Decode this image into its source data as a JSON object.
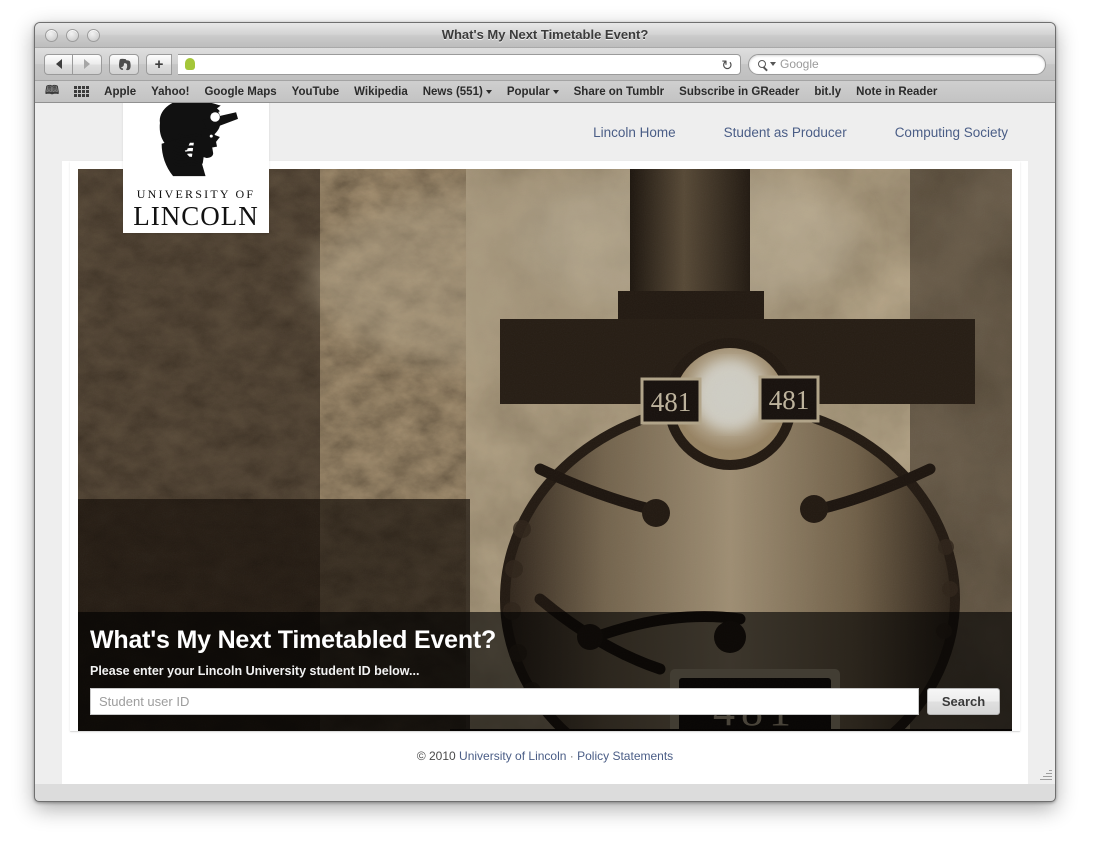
{
  "window": {
    "title": "What's My Next Timetable Event?",
    "traffic_lights": [
      "close-button",
      "minimize-button",
      "zoom-button"
    ]
  },
  "toolbar": {
    "back_icon": "back-arrow-icon",
    "forward_icon": "forward-arrow-icon",
    "evernote_icon": "evernote-elephant-icon",
    "new_tab_label": "+",
    "url_value": "",
    "url_favicon": "android-favicon",
    "reload_glyph": "↻",
    "search_placeholder": "Google",
    "search_icon": "magnifier-icon"
  },
  "bookmarks": {
    "reader_icon": "book-icon",
    "topsites_icon": "grid-icon",
    "items": [
      {
        "label": "Apple",
        "menu": false
      },
      {
        "label": "Yahoo!",
        "menu": false
      },
      {
        "label": "Google Maps",
        "menu": false
      },
      {
        "label": "YouTube",
        "menu": false
      },
      {
        "label": "Wikipedia",
        "menu": false
      },
      {
        "label": "News (551)",
        "menu": true
      },
      {
        "label": "Popular",
        "menu": true
      },
      {
        "label": "Share on Tumblr",
        "menu": false
      },
      {
        "label": "Subscribe in GReader",
        "menu": false
      },
      {
        "label": "bit.ly",
        "menu": false
      },
      {
        "label": "Note in Reader",
        "menu": false
      }
    ]
  },
  "page": {
    "topnav": [
      {
        "label": "Lincoln Home"
      },
      {
        "label": "Student as Producer"
      },
      {
        "label": "Computing Society"
      }
    ],
    "logo": {
      "crest_icon": "minerva-helmet-crest-icon",
      "line1": "UNIVERSITY OF",
      "line2": "LINCOLN"
    },
    "hero": {
      "image_alt": "sepia steam locomotive number 481",
      "locomotive_number": "481",
      "title": "What's My Next Timetabled Event?",
      "subtitle": "Please enter your Lincoln University student ID below...",
      "input_placeholder": "Student user ID",
      "input_value": "",
      "search_button": "Search"
    },
    "footer": {
      "copyright": "© 2010",
      "org_link": "University of Lincoln",
      "separator": "·",
      "policy_link": "Policy Statements"
    }
  },
  "colors": {
    "link": "#4a5d86",
    "page_bg": "#eeeeee",
    "hero_overlay": "rgba(0,0,0,0.62)"
  }
}
